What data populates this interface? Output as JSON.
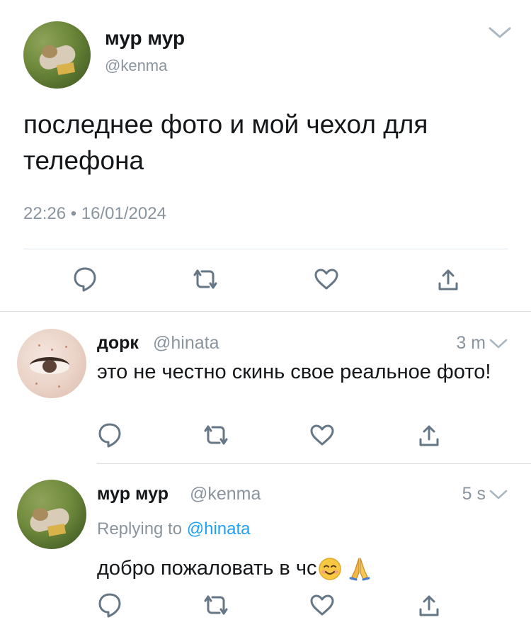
{
  "main_tweet": {
    "author_name": "мур мур",
    "author_handle": "@kenma",
    "text": "последнее фото и мой чехол для телефона",
    "timestamp": "22:26 • 16/01/2024",
    "icons": [
      "reply-icon",
      "retweet-icon",
      "like-icon",
      "share-icon",
      "chevron-down-icon"
    ]
  },
  "replies": [
    {
      "author_name": "дорк",
      "author_handle": "@hinata",
      "time": "3 m",
      "text": "это не честно скинь свое реальное фото!"
    },
    {
      "author_name": "мур мур",
      "author_handle": "@kenma",
      "time": "5 s",
      "replying_prefix": "Replying to",
      "replying_mention": "@hinata",
      "text": "добро пожаловать в чс",
      "emojis": [
        "smiling-face-emoji",
        "folded-hands-emoji"
      ]
    }
  ],
  "colors": {
    "text_primary": "#14171a",
    "text_secondary": "#8a949e",
    "link": "#1da1f2",
    "icon_gray": "#657786",
    "divider": "#e1e8ed"
  }
}
